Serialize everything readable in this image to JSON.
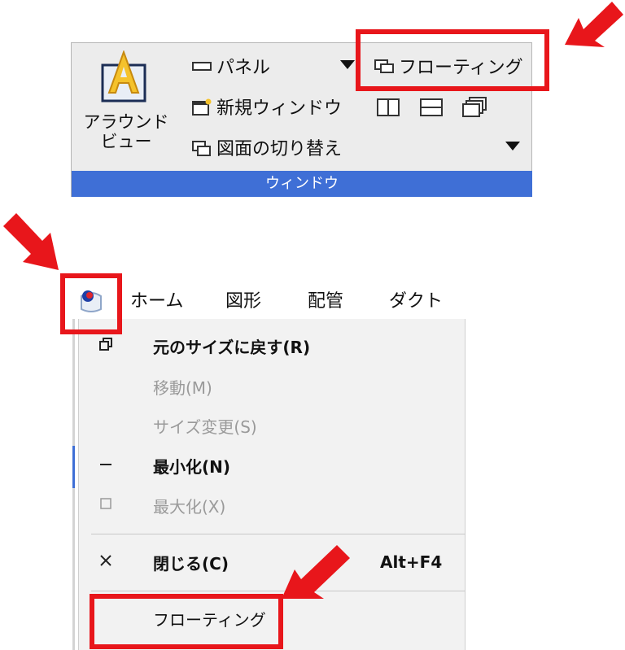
{
  "ribbon": {
    "aaround_label_line1": "アラウンド",
    "aaround_label_line2": "ビュー",
    "panel_label": "パネル",
    "new_window_label": "新規ウィンドウ",
    "switch_drawing_label": "図面の切り替え",
    "floating_label": "フローティング",
    "group_label": "ウィンドウ",
    "footer_color": "#3f6fd6"
  },
  "menubar": {
    "items": [
      "ホーム",
      "図形",
      "配管",
      "ダクト"
    ]
  },
  "system_menu": {
    "restore": "元のサイズに戻す(R)",
    "move": "移動(M)",
    "size": "サイズ変更(S)",
    "minimize": "最小化(N)",
    "maximize": "最大化(X)",
    "close": "閉じる(C)",
    "close_shortcut": "Alt+F4",
    "floating": "フローティング"
  },
  "icons": {
    "restore": "restore-icon",
    "minimize": "minimize-icon",
    "maximize": "maximize-icon",
    "close": "close-icon"
  },
  "highlight_color": "#e8161b"
}
